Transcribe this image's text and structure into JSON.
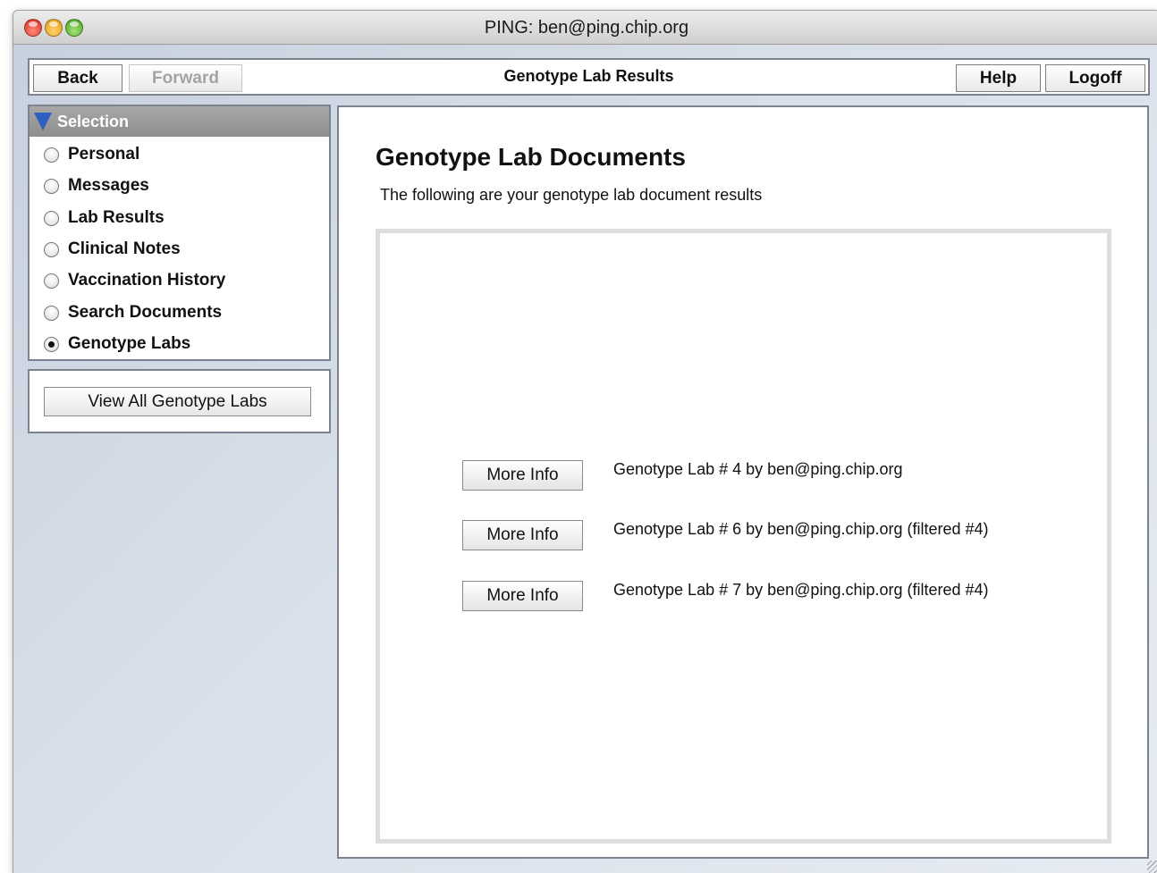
{
  "window": {
    "title": "PING: ben@ping.chip.org"
  },
  "toolbar": {
    "back_label": "Back",
    "forward_label": "Forward",
    "title": "Genotype Lab Results",
    "help_label": "Help",
    "logoff_label": "Logoff"
  },
  "sidebar": {
    "header": "Selection",
    "items": [
      {
        "label": "Personal",
        "selected": false
      },
      {
        "label": "Messages",
        "selected": false
      },
      {
        "label": "Lab Results",
        "selected": false
      },
      {
        "label": "Clinical Notes",
        "selected": false
      },
      {
        "label": "Vaccination History",
        "selected": false
      },
      {
        "label": "Search Documents",
        "selected": false
      },
      {
        "label": "Genotype Labs",
        "selected": true
      }
    ],
    "action_label": "View All Genotype Labs"
  },
  "main": {
    "heading": "Genotype Lab Documents",
    "subtitle": "The following are your genotype lab document results",
    "documents": [
      {
        "button_label": "More Info",
        "text": "Genotype Lab # 4 by ben@ping.chip.org"
      },
      {
        "button_label": "More Info",
        "text": "Genotype Lab # 6 by ben@ping.chip.org (filtered #4)"
      },
      {
        "button_label": "More Info",
        "text": "Genotype Lab # 7 by ben@ping.chip.org (filtered #4)"
      }
    ]
  },
  "colors": {
    "panel_border": "#7b8290",
    "selection_header": "#999999",
    "header_triangle": "#2f5fbf",
    "window_background": "#d3dbe6"
  }
}
